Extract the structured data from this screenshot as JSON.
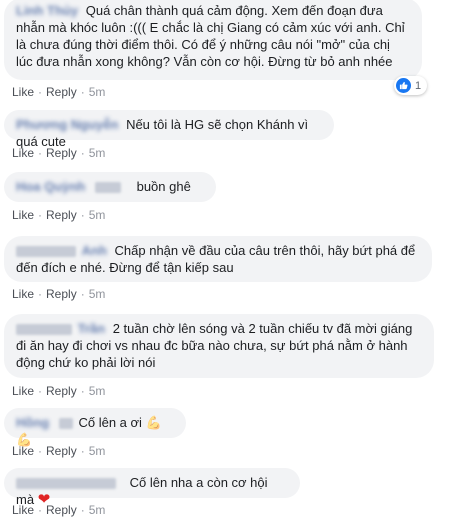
{
  "actions": {
    "like": "Like",
    "reply": "Reply",
    "separator": "·"
  },
  "colors": {
    "bubble": "#f2f3f5",
    "link": "#385898",
    "like_blue": "#1877f2",
    "heart": "#e02424"
  },
  "comments": [
    {
      "name": "Linh Thủy",
      "text": "Quá chân thành quá cảm động. Xem đến đoạn đưa nhẫn mà khóc luôn :((( E chắc là chị Giang có cảm xúc với anh. Chỉ là chưa đúng thời điểm thôi. Có để ý những câu nói \"mở\" của chị lúc đưa nhẫn xong không? Vẫn còn cơ hội. Đừng từ bỏ anh nhée",
      "time": "5m",
      "reaction_count": "1"
    },
    {
      "name": "Phương Nguyễn",
      "text": "Nếu tôi là HG sẽ chọn Khánh vì quá cute",
      "time": "5m"
    },
    {
      "name": "Hoa Quỳnh",
      "text": "buồn ghê",
      "time": "5m"
    },
    {
      "name": "Anh",
      "text": "Chấp nhận về đầu của câu trên thôi, hãy bứt phá để đến đích e nhé. Đừng để tận kiếp sau",
      "time": "5m"
    },
    {
      "name": "Trần",
      "text": "2 tuần chờ lên sóng và 2 tuần chiếu tv đã mời giáng đi ăn hay đi chơi vs nhau đc bữa nào chưa, sự bứt phá nằm ở hành động chứ ko phải lời nói",
      "time": "5m"
    },
    {
      "name": "Hồng",
      "text": "Cố lên a ơi",
      "emoji": "💪💪",
      "time": "5m"
    },
    {
      "name": "",
      "text": "Cố lên nha a còn cơ hội mà",
      "emoji": "❤",
      "time": "5m"
    }
  ]
}
